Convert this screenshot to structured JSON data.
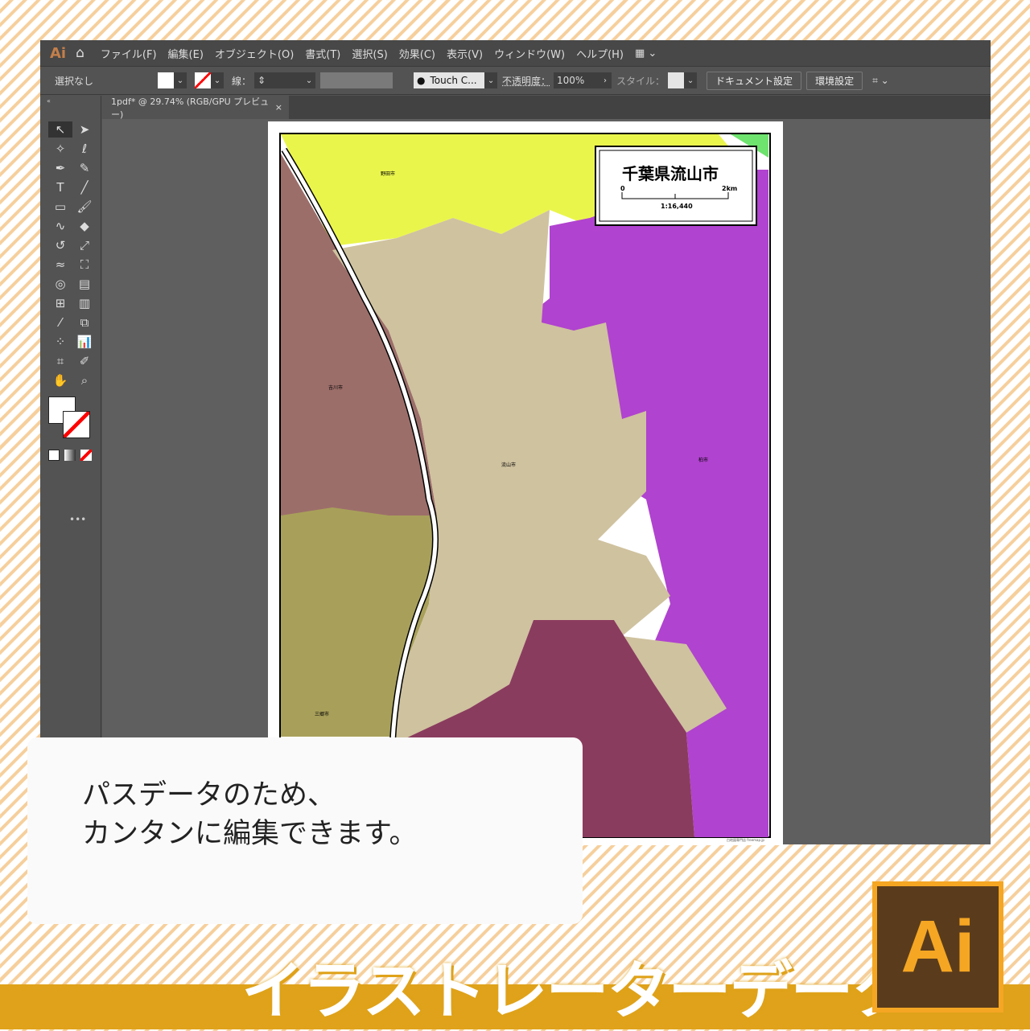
{
  "menu": {
    "logo": "Ai",
    "items": [
      "ファイル(F)",
      "編集(E)",
      "オブジェクト(O)",
      "書式(T)",
      "選択(S)",
      "効果(C)",
      "表示(V)",
      "ウィンドウ(W)",
      "ヘルプ(H)"
    ]
  },
  "control": {
    "selection": "選択なし",
    "stroke_label": "線：",
    "brush": "Touch C...",
    "opacity_label": "不透明度：",
    "opacity": "100%",
    "style_label": "スタイル：",
    "doc_settings": "ドキュメント設定",
    "preferences": "環境設定"
  },
  "tab": {
    "title": "1pdf* @ 29.74% (RGB/GPU プレビュー)",
    "close": "×"
  },
  "map": {
    "title": "千葉県流山市",
    "scale_start": "0",
    "scale_end": "2km",
    "scale_ratio": "1:16,440",
    "credit": "白地図専門店 freemap.jp",
    "labels": {
      "noda": "野田市",
      "yoshikawa": "吉川市",
      "nagareyama": "流山市",
      "kashiwa": "柏市",
      "misato": "三郷市"
    },
    "colors": {
      "noda": "#eaf54c",
      "yoshikawa": "#9c6e6a",
      "nagareyama": "#cfc29f",
      "kashiwa": "#b043cf",
      "misato": "#a8a05a",
      "matsudo": "#8a3c5e",
      "green": "#6ee36e"
    }
  },
  "note": {
    "line1": "パスデータのため、",
    "line2": "カンタンに編集できます。"
  },
  "banner": {
    "title": "イラストレーターデータ",
    "logo": "Ai"
  }
}
